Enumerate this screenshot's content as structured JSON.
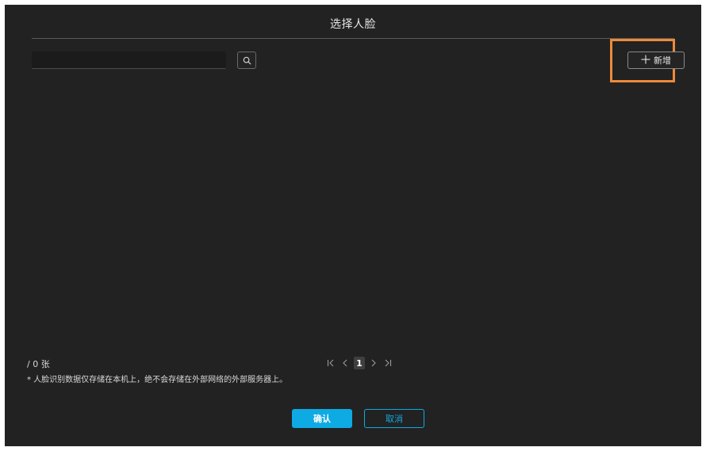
{
  "dialog": {
    "title": "选择人脸"
  },
  "search": {
    "value": "",
    "placeholder": "",
    "icon": "search-icon"
  },
  "toolbar": {
    "add_label": "新增",
    "add_icon": "plus-icon",
    "highlight_color": "#ee8a3a"
  },
  "footer": {
    "count_text": "/ 0 张",
    "note_text": "* 人脸识别数据仅存储在本机上，绝不会存储在外部网络的外部服务器上。"
  },
  "pagination": {
    "current_page": "1",
    "first_icon": "first-page-icon",
    "prev_icon": "prev-page-icon",
    "next_icon": "next-page-icon",
    "last_icon": "last-page-icon"
  },
  "actions": {
    "confirm_label": "确认",
    "cancel_label": "取消"
  },
  "colors": {
    "background": "#222222",
    "accent": "#0eaae3"
  }
}
